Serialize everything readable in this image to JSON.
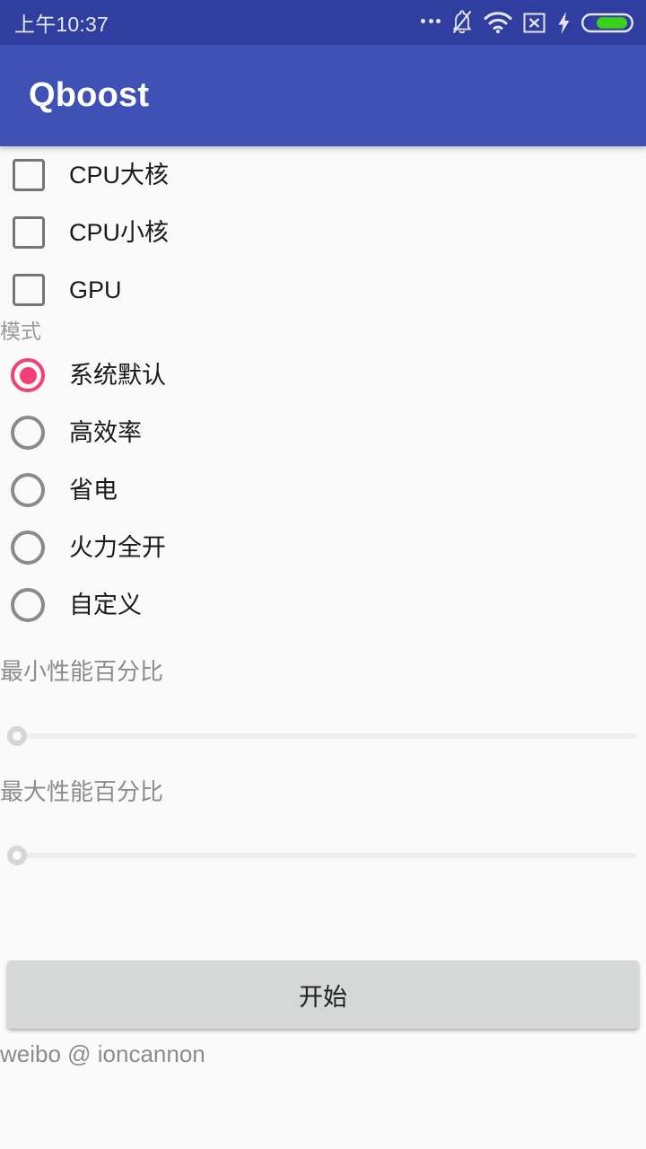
{
  "status_bar": {
    "clock": "上午10:37",
    "background_color": "#303F9F",
    "icons": [
      {
        "name": "more-dots-icon",
        "label": "..."
      },
      {
        "name": "notifications-muted-icon",
        "label": "铃声静音"
      },
      {
        "name": "wifi-icon",
        "label": "Wi-Fi"
      },
      {
        "name": "no-sim-icon",
        "label": "无SIM卡"
      },
      {
        "name": "charging-bolt-icon",
        "label": "充电中"
      },
      {
        "name": "battery-icon",
        "label": "电池"
      }
    ],
    "battery_fill_color": "#3BD01B",
    "battery_level_percent": 62
  },
  "app_bar": {
    "title": "Qboost",
    "background_color": "#3F51B5",
    "title_color": "#FFFFFF"
  },
  "checkboxes": [
    {
      "label": "CPU大核",
      "checked": false
    },
    {
      "label": "CPU小核",
      "checked": false
    },
    {
      "label": "GPU",
      "checked": false
    }
  ],
  "mode_section": {
    "label": "模式",
    "selected_color": "#F43F76",
    "options": [
      {
        "label": "系统默认",
        "selected": true
      },
      {
        "label": "高效率",
        "selected": false
      },
      {
        "label": "省电",
        "selected": false
      },
      {
        "label": "火力全开",
        "selected": false
      },
      {
        "label": "自定义",
        "selected": false
      }
    ]
  },
  "sliders": [
    {
      "label": "最小性能百分比",
      "value": 0,
      "min": 0,
      "max": 100
    },
    {
      "label": "最大性能百分比",
      "value": 0,
      "min": 0,
      "max": 100
    }
  ],
  "start_button": {
    "label": "开始"
  },
  "footer": {
    "text": "weibo @ ioncannon"
  }
}
